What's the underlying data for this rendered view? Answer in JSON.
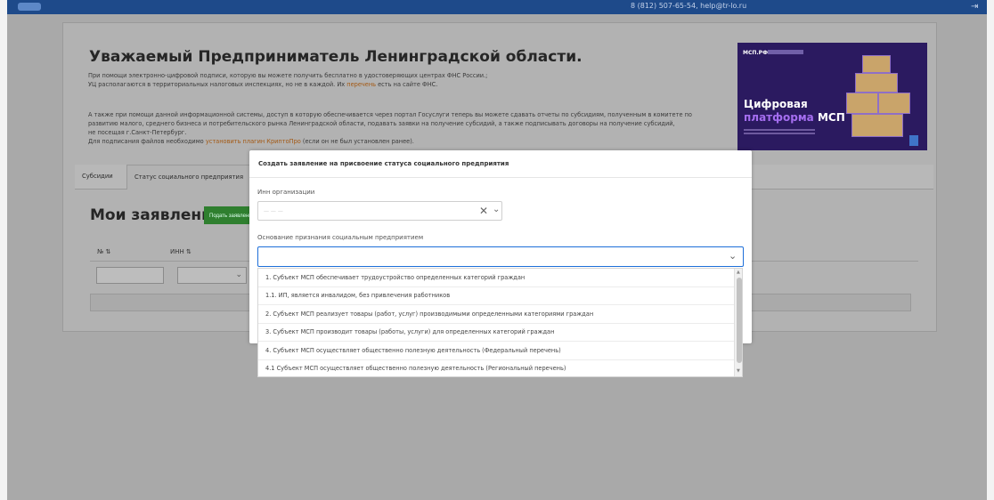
{
  "topbar": {
    "contact": "8 (812) 507-65-54, help@tr-lo.ru"
  },
  "intro": {
    "title": "Уважаемый Предприниматель Ленинградской области.",
    "p1": "При помощи электронно-цифровой подписи, которую вы можете получить бесплатно в удостоверяющих центрах ФНС России.;",
    "p2_start": "УЦ располагаются в территориальных налоговых инспекциях, но не в каждой. Их ",
    "p2_link": "перечень",
    "p2_end": " есть на сайте ФНС.",
    "p3_l1": "А также при помощи данной информационной системы, доступ в которую обеспечивается через портал Госуслуги теперь вы можете сдавать отчеты по субсидиям, полученным в комитете по",
    "p3_l2": "развитию малого, среднего бизнеса и потребительского рынка Ленинградской области, подавать заявки на получение субсидий, а также подписывать договоры на получение субсидий,",
    "p3_l3": "не посещая г.Санкт-Петербург.",
    "p4_start": "Для подписания файлов необходимо ",
    "p4_link": "установить плагин КриптоПро",
    "p4_end": " (если он не был установлен ранее)."
  },
  "banner": {
    "logo": "МСП.РФ",
    "title": "Цифровая",
    "subtitle_word": "платформа",
    "subtitle_bold": "МСП"
  },
  "tabs": [
    "Субсидии",
    "Статус социального предприятия"
  ],
  "applications": {
    "title": "Мои заявления",
    "submit_label": "Подать заявление",
    "col_number": "№ ⇅",
    "col_inn": "ИНН ⇅",
    "filter_chevron": "⌄"
  },
  "modal": {
    "title": "Создать заявление на присвоение статуса социального предприятия",
    "inn_label": "Инн организации",
    "inn_placeholder": "— — —",
    "reason_label": "Основание признания социальным предприятием",
    "reason_value": "",
    "clear_glyph": "✕",
    "chevron_glyph": "⌄"
  },
  "dropdown": {
    "options": [
      "1. Субъект МСП обеспечивает трудоустройство определенных категорий граждан",
      "1.1. ИП, является инвалидом, без привлечения работников",
      "2. Субъект МСП реализует товары (работ, услуг) производимыми определенными категориями граждан",
      "3. Субъект МСП производит товары (работы, услуги) для определенных категорий граждан",
      "4. Субъект МСП осуществляет общественно полезную деятельность (Федеральный перечень)",
      "4.1 Субъект МСП осуществляет общественно полезную деятельность (Региональный перечень)"
    ]
  },
  "colors": {
    "topbar": "#1e4a8a",
    "overlay_bg": "#a9a9a9",
    "accent_blue": "#1e6fd9",
    "submit_green": "#2f7f2f",
    "link_orange": "#a35812",
    "banner_purple": "#2b1a60"
  }
}
